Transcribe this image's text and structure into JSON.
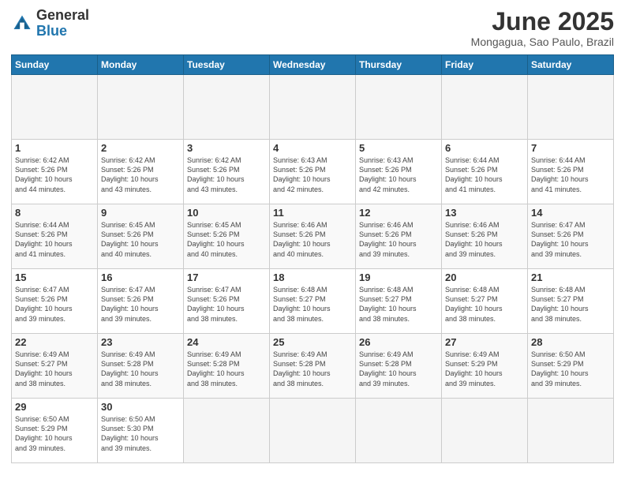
{
  "logo": {
    "general": "General",
    "blue": "Blue"
  },
  "title": "June 2025",
  "subtitle": "Mongagua, Sao Paulo, Brazil",
  "weekdays": [
    "Sunday",
    "Monday",
    "Tuesday",
    "Wednesday",
    "Thursday",
    "Friday",
    "Saturday"
  ],
  "days": [
    {
      "num": "",
      "info": ""
    },
    {
      "num": "",
      "info": ""
    },
    {
      "num": "",
      "info": ""
    },
    {
      "num": "",
      "info": ""
    },
    {
      "num": "",
      "info": ""
    },
    {
      "num": "",
      "info": ""
    },
    {
      "num": "",
      "info": ""
    },
    {
      "num": "1",
      "info": "Sunrise: 6:42 AM\nSunset: 5:26 PM\nDaylight: 10 hours\nand 44 minutes."
    },
    {
      "num": "2",
      "info": "Sunrise: 6:42 AM\nSunset: 5:26 PM\nDaylight: 10 hours\nand 43 minutes."
    },
    {
      "num": "3",
      "info": "Sunrise: 6:42 AM\nSunset: 5:26 PM\nDaylight: 10 hours\nand 43 minutes."
    },
    {
      "num": "4",
      "info": "Sunrise: 6:43 AM\nSunset: 5:26 PM\nDaylight: 10 hours\nand 42 minutes."
    },
    {
      "num": "5",
      "info": "Sunrise: 6:43 AM\nSunset: 5:26 PM\nDaylight: 10 hours\nand 42 minutes."
    },
    {
      "num": "6",
      "info": "Sunrise: 6:44 AM\nSunset: 5:26 PM\nDaylight: 10 hours\nand 41 minutes."
    },
    {
      "num": "7",
      "info": "Sunrise: 6:44 AM\nSunset: 5:26 PM\nDaylight: 10 hours\nand 41 minutes."
    },
    {
      "num": "8",
      "info": "Sunrise: 6:44 AM\nSunset: 5:26 PM\nDaylight: 10 hours\nand 41 minutes."
    },
    {
      "num": "9",
      "info": "Sunrise: 6:45 AM\nSunset: 5:26 PM\nDaylight: 10 hours\nand 40 minutes."
    },
    {
      "num": "10",
      "info": "Sunrise: 6:45 AM\nSunset: 5:26 PM\nDaylight: 10 hours\nand 40 minutes."
    },
    {
      "num": "11",
      "info": "Sunrise: 6:46 AM\nSunset: 5:26 PM\nDaylight: 10 hours\nand 40 minutes."
    },
    {
      "num": "12",
      "info": "Sunrise: 6:46 AM\nSunset: 5:26 PM\nDaylight: 10 hours\nand 39 minutes."
    },
    {
      "num": "13",
      "info": "Sunrise: 6:46 AM\nSunset: 5:26 PM\nDaylight: 10 hours\nand 39 minutes."
    },
    {
      "num": "14",
      "info": "Sunrise: 6:47 AM\nSunset: 5:26 PM\nDaylight: 10 hours\nand 39 minutes."
    },
    {
      "num": "15",
      "info": "Sunrise: 6:47 AM\nSunset: 5:26 PM\nDaylight: 10 hours\nand 39 minutes."
    },
    {
      "num": "16",
      "info": "Sunrise: 6:47 AM\nSunset: 5:26 PM\nDaylight: 10 hours\nand 39 minutes."
    },
    {
      "num": "17",
      "info": "Sunrise: 6:47 AM\nSunset: 5:26 PM\nDaylight: 10 hours\nand 38 minutes."
    },
    {
      "num": "18",
      "info": "Sunrise: 6:48 AM\nSunset: 5:27 PM\nDaylight: 10 hours\nand 38 minutes."
    },
    {
      "num": "19",
      "info": "Sunrise: 6:48 AM\nSunset: 5:27 PM\nDaylight: 10 hours\nand 38 minutes."
    },
    {
      "num": "20",
      "info": "Sunrise: 6:48 AM\nSunset: 5:27 PM\nDaylight: 10 hours\nand 38 minutes."
    },
    {
      "num": "21",
      "info": "Sunrise: 6:48 AM\nSunset: 5:27 PM\nDaylight: 10 hours\nand 38 minutes."
    },
    {
      "num": "22",
      "info": "Sunrise: 6:49 AM\nSunset: 5:27 PM\nDaylight: 10 hours\nand 38 minutes."
    },
    {
      "num": "23",
      "info": "Sunrise: 6:49 AM\nSunset: 5:28 PM\nDaylight: 10 hours\nand 38 minutes."
    },
    {
      "num": "24",
      "info": "Sunrise: 6:49 AM\nSunset: 5:28 PM\nDaylight: 10 hours\nand 38 minutes."
    },
    {
      "num": "25",
      "info": "Sunrise: 6:49 AM\nSunset: 5:28 PM\nDaylight: 10 hours\nand 38 minutes."
    },
    {
      "num": "26",
      "info": "Sunrise: 6:49 AM\nSunset: 5:28 PM\nDaylight: 10 hours\nand 39 minutes."
    },
    {
      "num": "27",
      "info": "Sunrise: 6:49 AM\nSunset: 5:29 PM\nDaylight: 10 hours\nand 39 minutes."
    },
    {
      "num": "28",
      "info": "Sunrise: 6:50 AM\nSunset: 5:29 PM\nDaylight: 10 hours\nand 39 minutes."
    },
    {
      "num": "29",
      "info": "Sunrise: 6:50 AM\nSunset: 5:29 PM\nDaylight: 10 hours\nand 39 minutes."
    },
    {
      "num": "30",
      "info": "Sunrise: 6:50 AM\nSunset: 5:30 PM\nDaylight: 10 hours\nand 39 minutes."
    },
    {
      "num": "",
      "info": ""
    },
    {
      "num": "",
      "info": ""
    },
    {
      "num": "",
      "info": ""
    },
    {
      "num": "",
      "info": ""
    },
    {
      "num": "",
      "info": ""
    }
  ]
}
